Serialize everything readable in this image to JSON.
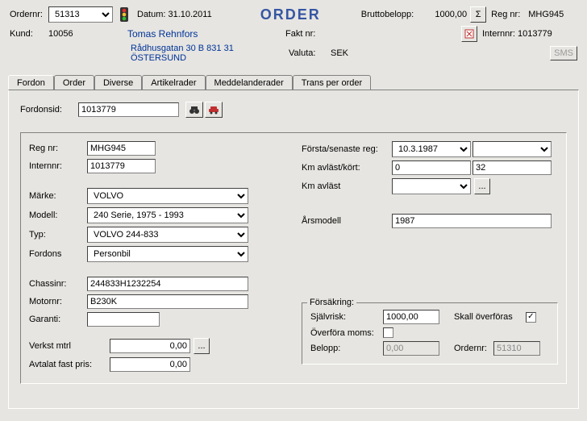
{
  "header": {
    "ordernr_label": "Ordernr:",
    "ordernr": "51313",
    "datum_label": "Datum:",
    "datum": "31.10.2011",
    "title": "ORDER",
    "brutto_label": "Bruttobelopp:",
    "brutto": "1000,00",
    "regnr_label": "Reg nr:",
    "regnr": "MHG945",
    "kund_label": "Kund:",
    "kund": "10056",
    "kund_name": "Tomas Rehnfors",
    "kund_addr": "Rådhusgatan 30 B 831 31 ÖSTERSUND",
    "faktnr_label": "Fakt nr:",
    "faktnr": "",
    "internnr_label": "Internnr:",
    "internnr": "1013779",
    "valuta_label": "Valuta:",
    "valuta": "SEK",
    "sms": "SMS"
  },
  "tabs": [
    "Fordon",
    "Order",
    "Diverse",
    "Artikelrader",
    "Meddelanderader",
    "Trans per order"
  ],
  "fordon": {
    "id_label": "Fordonsid:",
    "id": "1013779",
    "regnr_label": "Reg nr:",
    "regnr": "MHG945",
    "internnr_label": "Internnr:",
    "internnr": "1013779",
    "marke_label": "Märke:",
    "marke": "VOLVO",
    "modell_label": "Modell:",
    "modell": "240 Serie, 1975 - 1993",
    "typ_label": "Typ:",
    "typ": "VOLVO 244-833",
    "fordons_label": "Fordons",
    "fordons": "Personbil",
    "chassinr_label": "Chassinr:",
    "chassinr": "244833H1232254",
    "motornr_label": "Motornr:",
    "motornr": "B230K",
    "garanti_label": "Garanti:",
    "garanti": "",
    "verkst_label": "Verkst mtrl",
    "verkst": "0,00",
    "avtalat_label": "Avtalat fast pris:",
    "avtalat": "0,00",
    "forsta_label": "Första/senaste reg:",
    "forsta": "10.3.1987",
    "senaste": "",
    "km_avlast_kort_label": "Km avläst/kört:",
    "km_avlast": "0",
    "km_kort": "32",
    "km_avlast2_label": "Km avläst",
    "km_avlast2": "",
    "arsmodell_label": "Årsmodell",
    "arsmodell": "1987",
    "ellipsis": "..."
  },
  "forsakring": {
    "legend": "Försäkring:",
    "sjalvrisk_label": "Självrisk:",
    "sjalvrisk": "1000,00",
    "skall_label": "Skall överföras",
    "overfora_moms_label": "Överföra moms:",
    "belopp_label": "Belopp:",
    "belopp": "0,00",
    "ordernr_label": "Ordernr:",
    "ordernr": "51310"
  }
}
